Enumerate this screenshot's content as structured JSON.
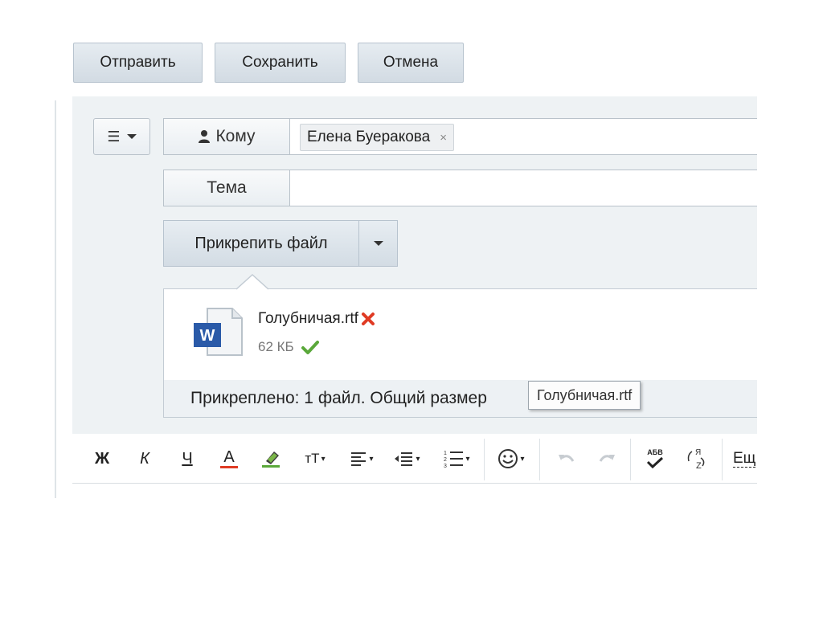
{
  "actions": {
    "send_label": "Отправить",
    "save_label": "Сохранить",
    "cancel_label": "Отмена"
  },
  "form": {
    "to_label": "Кому",
    "subject_label": "Тема",
    "subject_value": "",
    "recipients": [
      {
        "name": "Елена Буеракова",
        "remove": "×"
      }
    ],
    "attach_label": "Прикрепить файл"
  },
  "attachment": {
    "file_name": "Голубничая.rtf",
    "file_size": "62 КБ",
    "icon_letter": "W",
    "summary": "Прикреплено: 1 файл. Общий размер",
    "tooltip": "Голубничая.rtf"
  },
  "toolbar": {
    "bold": "Ж",
    "italic": "К",
    "underline": "Ч",
    "font_color": "А",
    "font_size": "тТ",
    "spell_label": "АБВ",
    "more": "Ещ"
  },
  "colors": {
    "accent_red": "#e03b24",
    "success_green": "#5aa83a",
    "word_blue": "#2a5aa8"
  }
}
